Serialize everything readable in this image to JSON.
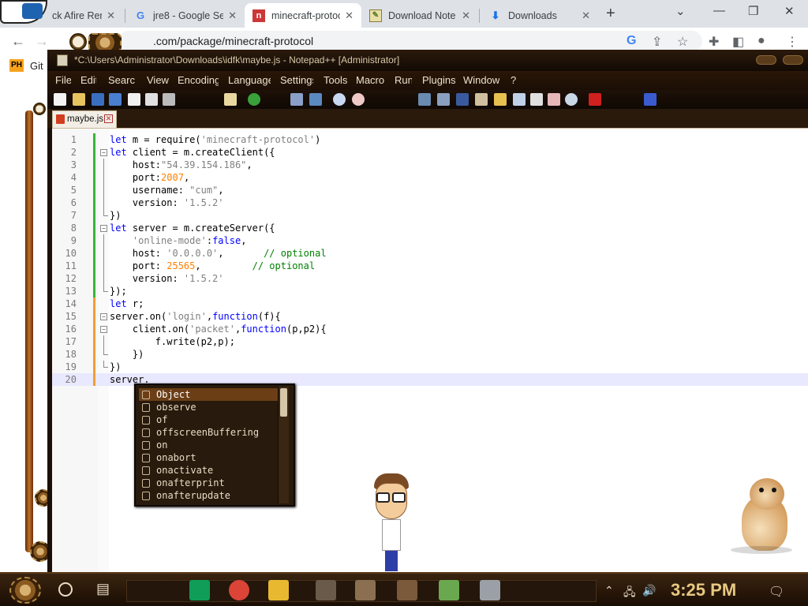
{
  "browser": {
    "tabs": [
      {
        "title": "ck Afire Reme",
        "icon": "fandom-icon",
        "active": false
      },
      {
        "title": "jre8 - Google Se",
        "icon": "google-icon",
        "active": false
      },
      {
        "title": "minecraft-protoc",
        "icon": "npm-icon",
        "active": true
      },
      {
        "title": "Download Note",
        "icon": "notepad-icon",
        "active": false
      },
      {
        "title": "Downloads",
        "icon": "download-icon",
        "active": false
      }
    ],
    "new_tab_symbol": "+",
    "url": ".com/package/minecraft-protocol",
    "bookmarks": [
      {
        "label": "PH",
        "icon": "ph-icon"
      },
      {
        "label": "Git",
        "icon": ""
      }
    ]
  },
  "npp": {
    "title": "*C:\\Users\\Administrator\\Downloads\\idfk\\maybe.js - Notepad++ [Administrator]",
    "menu": [
      "File",
      "Edit",
      "Search",
      "View",
      "Encoding",
      "Language",
      "Settings",
      "Tools",
      "Macro",
      "Run",
      "Plugins",
      "Window",
      "?"
    ],
    "active_tab": "maybe.js",
    "lines": [
      {
        "n": "1",
        "change": "green",
        "fold": "",
        "code": [
          [
            "kw",
            "let"
          ],
          [
            "t",
            " m = require("
          ],
          [
            "str",
            "'minecraft-protocol'"
          ],
          [
            "t",
            ")"
          ]
        ]
      },
      {
        "n": "2",
        "change": "green",
        "fold": "box",
        "code": [
          [
            "kw",
            "let"
          ],
          [
            "t",
            " client = m.createClient({"
          ]
        ]
      },
      {
        "n": "3",
        "change": "green",
        "fold": "line",
        "code": [
          [
            "t",
            "    host:"
          ],
          [
            "str",
            "\"54.39.154.186\""
          ],
          [
            "t",
            ","
          ]
        ]
      },
      {
        "n": "4",
        "change": "green",
        "fold": "line",
        "code": [
          [
            "t",
            "    port:"
          ],
          [
            "num",
            "2007"
          ],
          [
            "t",
            ","
          ]
        ]
      },
      {
        "n": "5",
        "change": "green",
        "fold": "line",
        "code": [
          [
            "t",
            "    username: "
          ],
          [
            "str",
            "\"cum\""
          ],
          [
            "t",
            ","
          ]
        ]
      },
      {
        "n": "6",
        "change": "green",
        "fold": "line",
        "code": [
          [
            "t",
            "    version: "
          ],
          [
            "str",
            "'1.5.2'"
          ]
        ]
      },
      {
        "n": "7",
        "change": "green",
        "fold": "end",
        "code": [
          [
            "t",
            "})"
          ]
        ]
      },
      {
        "n": "8",
        "change": "green",
        "fold": "box",
        "code": [
          [
            "kw",
            "let"
          ],
          [
            "t",
            " server = m.createServer({"
          ]
        ]
      },
      {
        "n": "9",
        "change": "green",
        "fold": "line",
        "code": [
          [
            "t",
            "    "
          ],
          [
            "str",
            "'online-mode'"
          ],
          [
            "t",
            ":"
          ],
          [
            "kw",
            "false"
          ],
          [
            "t",
            ","
          ]
        ]
      },
      {
        "n": "10",
        "change": "green",
        "fold": "line",
        "code": [
          [
            "t",
            "    host: "
          ],
          [
            "str",
            "'0.0.0.0'"
          ],
          [
            "t",
            ",       "
          ],
          [
            "cmt",
            "// optional"
          ]
        ]
      },
      {
        "n": "11",
        "change": "green",
        "fold": "line",
        "code": [
          [
            "t",
            "    port: "
          ],
          [
            "num",
            "25565"
          ],
          [
            "t",
            ",         "
          ],
          [
            "cmt",
            "// optional"
          ]
        ]
      },
      {
        "n": "12",
        "change": "green",
        "fold": "line",
        "code": [
          [
            "t",
            "    version: "
          ],
          [
            "str",
            "'1.5.2'"
          ]
        ]
      },
      {
        "n": "13",
        "change": "green",
        "fold": "end",
        "code": [
          [
            "t",
            "});"
          ]
        ]
      },
      {
        "n": "14",
        "change": "orange",
        "fold": "",
        "code": [
          [
            "kw",
            "let"
          ],
          [
            "t",
            " r;"
          ]
        ]
      },
      {
        "n": "15",
        "change": "orange",
        "fold": "box",
        "code": [
          [
            "t",
            "server.on("
          ],
          [
            "str",
            "'login'"
          ],
          [
            "t",
            ","
          ],
          [
            "kw",
            "function"
          ],
          [
            "t",
            "(f){"
          ]
        ]
      },
      {
        "n": "16",
        "change": "orange",
        "fold": "box",
        "code": [
          [
            "t",
            "    client.on("
          ],
          [
            "str",
            "'packet'"
          ],
          [
            "t",
            ","
          ],
          [
            "kw",
            "function"
          ],
          [
            "t",
            "(p,p2){"
          ]
        ]
      },
      {
        "n": "17",
        "change": "orange",
        "fold": "line",
        "code": [
          [
            "t",
            "        f.write(p2,p);"
          ]
        ]
      },
      {
        "n": "18",
        "change": "orange",
        "fold": "end",
        "code": [
          [
            "t",
            "    })"
          ]
        ]
      },
      {
        "n": "19",
        "change": "orange",
        "fold": "end",
        "code": [
          [
            "t",
            "})"
          ]
        ]
      },
      {
        "n": "20",
        "change": "orange",
        "fold": "",
        "code": [
          [
            "t",
            "server."
          ]
        ]
      }
    ],
    "autocomplete": [
      "Object",
      "observe",
      "of",
      "offscreenBuffering",
      "on",
      "onabort",
      "onactivate",
      "onafterprint",
      "onafterupdate"
    ],
    "autocomplete_selected": 0
  },
  "taskbar": {
    "clock": "3:25 PM",
    "apps": [
      {
        "name": "sheets",
        "color": "#0f9d58"
      },
      {
        "name": "chrome",
        "color": "#db4437"
      },
      {
        "name": "file-explorer",
        "color": "#e8b830"
      },
      {
        "name": "utility",
        "color": "#6a5a4a"
      },
      {
        "name": "tool",
        "color": "#8a7050"
      },
      {
        "name": "minecraft",
        "color": "#7a5a3a"
      },
      {
        "name": "notepadpp",
        "color": "#6aa84f"
      },
      {
        "name": "remote",
        "color": "#9aa0a6"
      }
    ]
  },
  "colors": {
    "keyword": "#0000ff",
    "string": "#808080",
    "number": "#ff8000",
    "comment": "#008000",
    "change_saved": "#35b735",
    "change_unsaved": "#f39c36"
  }
}
